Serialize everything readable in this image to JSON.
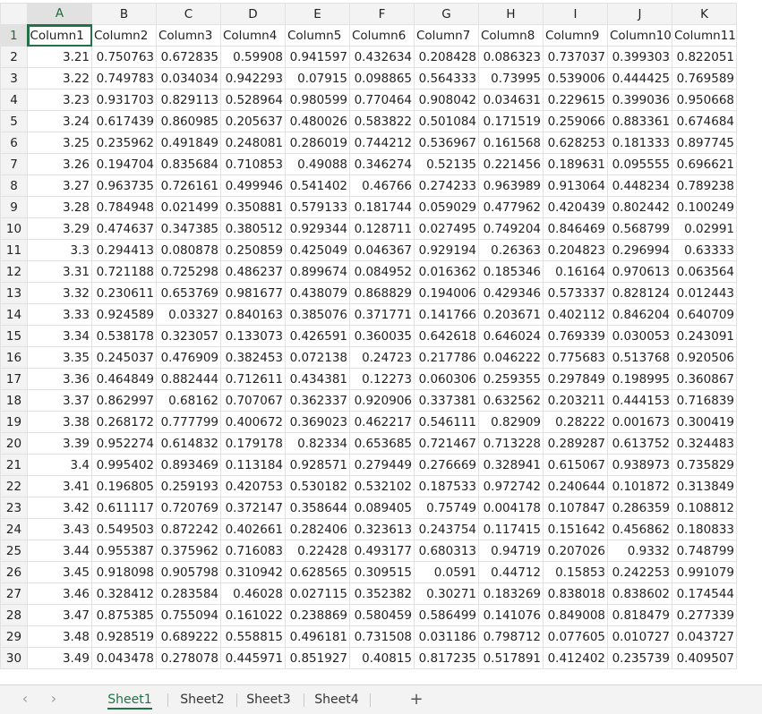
{
  "spreadsheet": {
    "column_letters": [
      "A",
      "B",
      "C",
      "D",
      "E",
      "F",
      "G",
      "H",
      "I",
      "J",
      "K"
    ],
    "row_numbers": [
      1,
      2,
      3,
      4,
      5,
      6,
      7,
      8,
      9,
      10,
      11,
      12,
      13,
      14,
      15,
      16,
      17,
      18,
      19,
      20,
      21,
      22,
      23,
      24,
      25,
      26,
      27,
      28,
      29,
      30
    ],
    "active_column": "A",
    "active_row": 1,
    "header_row": [
      "Column1",
      "Column2",
      "Column3",
      "Column4",
      "Column5",
      "Column6",
      "Column7",
      "Column8",
      "Column9",
      "Column10",
      "Column11"
    ],
    "rows": [
      [
        "3.21",
        "0.750763",
        "0.672835",
        "0.59908",
        "0.941597",
        "0.432634",
        "0.208428",
        "0.086323",
        "0.737037",
        "0.399303",
        "0.822051"
      ],
      [
        "3.22",
        "0.749783",
        "0.034034",
        "0.942293",
        "0.07915",
        "0.098865",
        "0.564333",
        "0.73995",
        "0.539006",
        "0.444425",
        "0.769589"
      ],
      [
        "3.23",
        "0.931703",
        "0.829113",
        "0.528964",
        "0.980599",
        "0.770464",
        "0.908042",
        "0.034631",
        "0.229615",
        "0.399036",
        "0.950668"
      ],
      [
        "3.24",
        "0.617439",
        "0.860985",
        "0.205637",
        "0.480026",
        "0.583822",
        "0.501084",
        "0.171519",
        "0.259066",
        "0.883361",
        "0.674684"
      ],
      [
        "3.25",
        "0.235962",
        "0.491849",
        "0.248081",
        "0.286019",
        "0.744212",
        "0.536967",
        "0.161568",
        "0.628253",
        "0.181333",
        "0.897745"
      ],
      [
        "3.26",
        "0.194704",
        "0.835684",
        "0.710853",
        "0.49088",
        "0.346274",
        "0.52135",
        "0.221456",
        "0.189631",
        "0.095555",
        "0.696621"
      ],
      [
        "3.27",
        "0.963735",
        "0.726161",
        "0.499946",
        "0.541402",
        "0.46766",
        "0.274233",
        "0.963989",
        "0.913064",
        "0.448234",
        "0.789238"
      ],
      [
        "3.28",
        "0.784948",
        "0.021499",
        "0.350881",
        "0.579133",
        "0.181744",
        "0.059029",
        "0.477962",
        "0.420439",
        "0.802442",
        "0.100249"
      ],
      [
        "3.29",
        "0.474637",
        "0.347385",
        "0.380512",
        "0.929344",
        "0.128711",
        "0.027495",
        "0.749204",
        "0.846469",
        "0.568799",
        "0.02991"
      ],
      [
        "3.3",
        "0.294413",
        "0.080878",
        "0.250859",
        "0.425049",
        "0.046367",
        "0.929194",
        "0.26363",
        "0.204823",
        "0.296994",
        "0.63333"
      ],
      [
        "3.31",
        "0.721188",
        "0.725298",
        "0.486237",
        "0.899674",
        "0.084952",
        "0.016362",
        "0.185346",
        "0.16164",
        "0.970613",
        "0.063564"
      ],
      [
        "3.32",
        "0.230611",
        "0.653769",
        "0.981677",
        "0.438079",
        "0.868829",
        "0.194006",
        "0.429346",
        "0.573337",
        "0.828124",
        "0.012443"
      ],
      [
        "3.33",
        "0.924589",
        "0.03327",
        "0.840163",
        "0.385076",
        "0.371771",
        "0.141766",
        "0.203671",
        "0.402112",
        "0.846204",
        "0.640709"
      ],
      [
        "3.34",
        "0.538178",
        "0.323057",
        "0.133073",
        "0.426591",
        "0.360035",
        "0.642618",
        "0.646024",
        "0.769339",
        "0.030053",
        "0.243091"
      ],
      [
        "3.35",
        "0.245037",
        "0.476909",
        "0.382453",
        "0.072138",
        "0.24723",
        "0.217786",
        "0.046222",
        "0.775683",
        "0.513768",
        "0.920506"
      ],
      [
        "3.36",
        "0.464849",
        "0.882444",
        "0.712611",
        "0.434381",
        "0.12273",
        "0.060306",
        "0.259355",
        "0.297849",
        "0.198995",
        "0.360867"
      ],
      [
        "3.37",
        "0.862997",
        "0.68162",
        "0.707067",
        "0.362337",
        "0.920906",
        "0.337381",
        "0.632562",
        "0.203211",
        "0.444153",
        "0.716839"
      ],
      [
        "3.38",
        "0.268172",
        "0.777799",
        "0.400672",
        "0.369023",
        "0.462217",
        "0.546111",
        "0.82909",
        "0.28222",
        "0.001673",
        "0.300419"
      ],
      [
        "3.39",
        "0.952274",
        "0.614832",
        "0.179178",
        "0.82334",
        "0.653685",
        "0.721467",
        "0.713228",
        "0.289287",
        "0.613752",
        "0.324483"
      ],
      [
        "3.4",
        "0.995402",
        "0.893469",
        "0.113184",
        "0.928571",
        "0.279449",
        "0.276669",
        "0.328941",
        "0.615067",
        "0.938973",
        "0.735829"
      ],
      [
        "3.41",
        "0.196805",
        "0.259193",
        "0.420753",
        "0.530182",
        "0.532102",
        "0.187533",
        "0.972742",
        "0.240644",
        "0.101872",
        "0.313849"
      ],
      [
        "3.42",
        "0.611117",
        "0.720769",
        "0.372147",
        "0.358644",
        "0.089405",
        "0.75749",
        "0.004178",
        "0.107847",
        "0.286359",
        "0.108812"
      ],
      [
        "3.43",
        "0.549503",
        "0.872242",
        "0.402661",
        "0.282406",
        "0.323613",
        "0.243754",
        "0.117415",
        "0.151642",
        "0.456862",
        "0.180833"
      ],
      [
        "3.44",
        "0.955387",
        "0.375962",
        "0.716083",
        "0.22428",
        "0.493177",
        "0.680313",
        "0.94719",
        "0.207026",
        "0.9332",
        "0.748799"
      ],
      [
        "3.45",
        "0.918098",
        "0.905798",
        "0.310942",
        "0.628565",
        "0.309515",
        "0.0591",
        "0.44712",
        "0.15853",
        "0.242253",
        "0.991079"
      ],
      [
        "3.46",
        "0.328412",
        "0.283584",
        "0.46028",
        "0.027115",
        "0.352382",
        "0.30271",
        "0.183269",
        "0.838018",
        "0.838602",
        "0.174544"
      ],
      [
        "3.47",
        "0.875385",
        "0.755094",
        "0.161022",
        "0.238869",
        "0.580459",
        "0.586499",
        "0.141076",
        "0.849008",
        "0.818479",
        "0.277339"
      ],
      [
        "3.48",
        "0.928519",
        "0.689222",
        "0.558815",
        "0.496181",
        "0.731508",
        "0.031186",
        "0.798712",
        "0.077605",
        "0.010727",
        "0.043727"
      ],
      [
        "3.49",
        "0.043478",
        "0.278078",
        "0.445971",
        "0.851927",
        "0.40815",
        "0.817235",
        "0.517891",
        "0.412402",
        "0.235739",
        "0.409507"
      ]
    ]
  },
  "tabbar": {
    "prev_arrow": "‹",
    "next_arrow": "›",
    "sheets": [
      "Sheet1",
      "Sheet2",
      "Sheet3",
      "Sheet4"
    ],
    "active_sheet": "Sheet1",
    "add_label": "+"
  },
  "colors": {
    "accent": "#217346",
    "header_bg": "#f3f3f3",
    "gridline": "#e1e1e1"
  }
}
